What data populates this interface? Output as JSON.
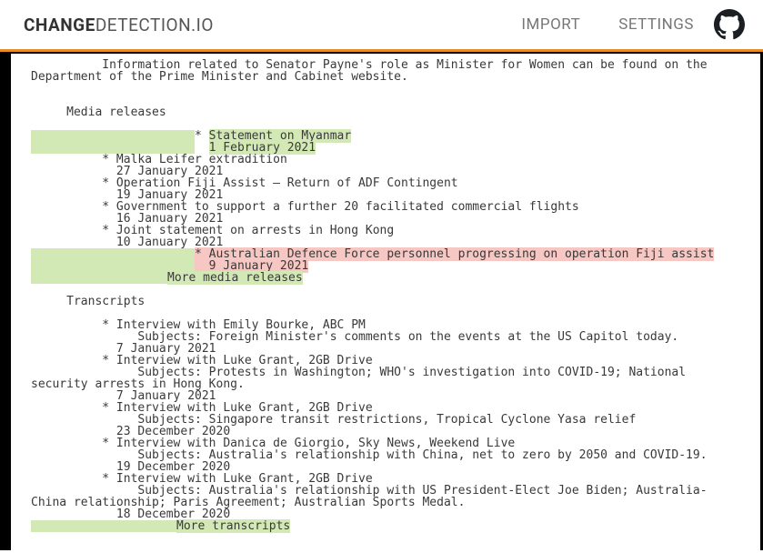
{
  "header": {
    "logo_bold": "CHANGE",
    "logo_rest": "DETECTION.IO",
    "nav_import": "IMPORT",
    "nav_settings": "SETTINGS"
  },
  "intro": {
    "line1_indent": "          ",
    "line1": "Information related to Senator Payne's role as Minister for Women can be found on the",
    "line2": "Department of the Prime Minister and Cabinet website."
  },
  "media": {
    "heading_indent": "     ",
    "heading": "Media releases",
    "items": [
      {
        "bullet": "          * ",
        "title": "Statement on Myanmar",
        "date": "1 February 2021",
        "status": "added"
      },
      {
        "bullet": "          * ",
        "title": "Malka Leifer extradition",
        "date": "27 January 2021",
        "status": "ctx"
      },
      {
        "bullet": "          * ",
        "title": "Operation Fiji Assist – Return of ADF Contingent",
        "date": "19 January 2021",
        "status": "ctx"
      },
      {
        "bullet": "          * ",
        "title": "Government to support a further 20 facilitated commercial flights",
        "date": "16 January 2021",
        "status": "ctx"
      },
      {
        "bullet": "          * ",
        "title": "Joint statement on arrests in Hong Kong",
        "date": "10 January 2021",
        "status": "ctx"
      },
      {
        "bullet": "          * ",
        "title": "Australian Defence Force personnel progressing on operation Fiji assist",
        "date": "9 January 2021",
        "status": "removed"
      }
    ],
    "more_indent": "        ",
    "more": "More media releases"
  },
  "transcripts": {
    "heading_indent": "     ",
    "heading": "Transcripts",
    "items": [
      {
        "bullet": "          * ",
        "title": "Interview with Emily Bourke, ABC PM",
        "subject_lead": "               ",
        "subject": "Subjects: Foreign Minister's comments on the events at the US Capitol today.",
        "date": "7 January 2021"
      },
      {
        "bullet": "          * ",
        "title": "Interview with Luke Grant, 2GB Drive",
        "subject_lead": "               ",
        "subject": "Subjects: Protests in Washington; WHO's investigation into COVID-19; National",
        "subject_cont": "security arrests in Hong Kong.",
        "date": "7 January 2021"
      },
      {
        "bullet": "          * ",
        "title": "Interview with Luke Grant, 2GB Drive",
        "subject_lead": "               ",
        "subject": "Subjects: Singapore transit restrictions, Tropical Cyclone Yasa relief",
        "date": "23 December 2020"
      },
      {
        "bullet": "          * ",
        "title": "Interview with Danica de Giorgio, Sky News, Weekend Live",
        "subject_lead": "               ",
        "subject": "Subjects: Australia's relationship with China, net to zero by 2050 and COVID-19.",
        "date": "19 December 2020"
      },
      {
        "bullet": "          * ",
        "title": "Interview with Luke Grant, 2GB Drive",
        "subject_lead": "               ",
        "subject": "Subjects: Australia's relationship with US President-Elect Joe Biden; Australia-",
        "subject_cont": "China relationship; Paris Agreement; Australian Sports Medal.",
        "date": "18 December 2020"
      }
    ],
    "more_indent": "        ",
    "more": "More transcripts"
  },
  "date_indent": "            "
}
